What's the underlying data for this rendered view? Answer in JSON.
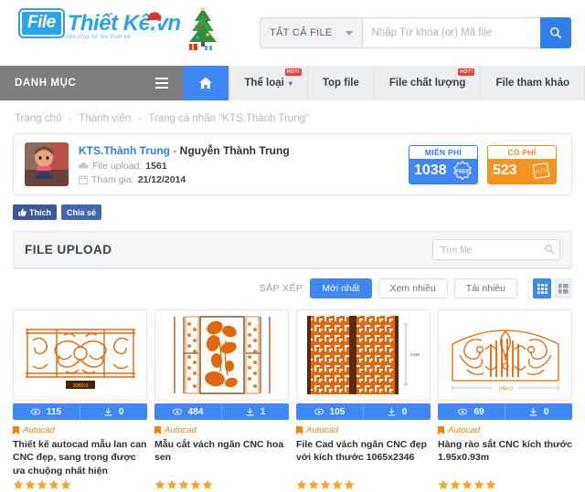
{
  "site": {
    "logo_file": "File",
    "logo_name": "Thiết Kế.vn",
    "logo_tagline": "Thư viện chia sẻ file thiết kế"
  },
  "search": {
    "category_label": "TẤT CẢ FILE",
    "placeholder": "Nhập Từ khóa (or) Mã file",
    "value": "",
    "button_icon": "search-icon"
  },
  "nav": {
    "category_label": "DANH MỤC",
    "home_icon": "home-icon",
    "items": [
      {
        "label": "Thể loại",
        "hot": "HOT!",
        "has_caret": true
      },
      {
        "label": "Top file",
        "hot": "",
        "has_caret": false
      },
      {
        "label": "File chất lượng",
        "hot": "HOT!",
        "has_caret": false
      },
      {
        "label": "File tham khảo",
        "hot": "",
        "has_caret": false
      }
    ]
  },
  "breadcrumb": {
    "items": [
      "Trang chủ",
      "Thành viên",
      "Trang cá nhân \"KTS.Thành Trung\""
    ],
    "separator": "›"
  },
  "profile": {
    "username": "KTS.Thành Trung",
    "dash": " - ",
    "fullname": "Nguyễn Thành Trung",
    "upload_label": "File upload:",
    "upload_count": "1561",
    "joined_label": "Tham gia:",
    "joined_date": "21/12/2014",
    "badges": [
      {
        "title": "MIỄN PHÍ",
        "count": "1038",
        "color": "#3f87f5",
        "icon": "free-seal-icon"
      },
      {
        "title": "CÓ PHÍ",
        "count": "523",
        "color": "#f5931f",
        "icon": "code-file-icon"
      }
    ]
  },
  "social": {
    "like_label": "Thích",
    "share_label": "Chia sẻ"
  },
  "panel": {
    "title": "FILE UPLOAD",
    "find_placeholder": "Tìm file",
    "find_value": ""
  },
  "sort": {
    "label": "SẮP XẾP",
    "options": [
      {
        "label": "Mới nhất",
        "active": true
      },
      {
        "label": "Xem nhiều",
        "active": false
      },
      {
        "label": "Tải nhiều",
        "active": false
      }
    ],
    "views": [
      {
        "name": "grid-view-icon",
        "active": true
      },
      {
        "name": "list-view-icon",
        "active": false
      }
    ]
  },
  "cards": [
    {
      "views": "115",
      "downloads": "0",
      "tag": "Autocad",
      "title": "Thiết kế autocad mẫu lan can CNC đẹp, sang trọng được ưa chuộng nhất hiện",
      "stars": 5,
      "dim_label": "3060.0",
      "thumb": "cnc-railing-scroll-pattern"
    },
    {
      "views": "484",
      "downloads": "1",
      "tag": "Autocad",
      "title": "Mẫu cắt vách ngăn CNC hoa sen",
      "stars": 5,
      "dim_label": "",
      "thumb": "cnc-lotus-partition"
    },
    {
      "views": "105",
      "downloads": "0",
      "tag": "Autocad",
      "title": "File Cad vách ngăn CNC đẹp với kích thước 1065x2346",
      "stars": 5,
      "dim_label": "2346",
      "thumb": "cnc-geometric-partition"
    },
    {
      "views": "69",
      "downloads": "0",
      "tag": "Autocad",
      "title": "Hàng rào sắt CNC kích thước 1.95x0.93m",
      "stars": 5,
      "dim_label": "1950.0",
      "thumb": "cnc-arched-iron-fence"
    }
  ]
}
